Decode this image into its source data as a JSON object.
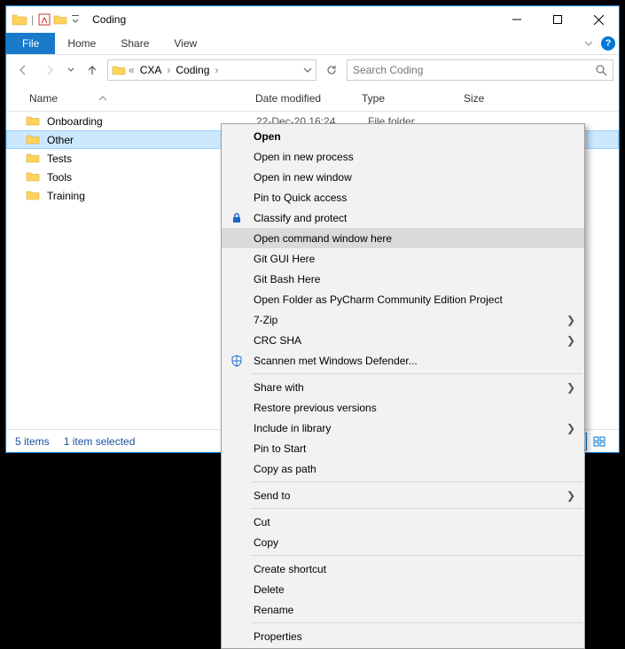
{
  "titlebar": {
    "title": "Coding"
  },
  "ribbon": {
    "file": "File",
    "home": "Home",
    "share": "Share",
    "view": "View"
  },
  "breadcrumb": {
    "prefix": "«",
    "seg1": "CXA",
    "seg2": "Coding"
  },
  "search": {
    "placeholder": "Search Coding"
  },
  "columns": {
    "name": "Name",
    "date": "Date modified",
    "type": "Type",
    "size": "Size"
  },
  "files": [
    {
      "name": "Onboarding",
      "date": "22-Dec-20 16:24",
      "type": "File folder",
      "selected": false
    },
    {
      "name": "Other",
      "date": "",
      "type": "",
      "selected": true
    },
    {
      "name": "Tests",
      "date": "",
      "type": "",
      "selected": false
    },
    {
      "name": "Tools",
      "date": "",
      "type": "",
      "selected": false
    },
    {
      "name": "Training",
      "date": "",
      "type": "",
      "selected": false
    }
  ],
  "status": {
    "items": "5 items",
    "selected": "1 item selected"
  },
  "context": {
    "open": "Open",
    "open_new_process": "Open in new process",
    "open_new_window": "Open in new window",
    "pin_quick": "Pin to Quick access",
    "classify": "Classify and protect",
    "open_cmd": "Open command window here",
    "git_gui": "Git GUI Here",
    "git_bash": "Git Bash Here",
    "pycharm": "Open Folder as PyCharm Community Edition Project",
    "sevenzip": "7-Zip",
    "crc": "CRC SHA",
    "defender": "Scannen met Windows Defender...",
    "share_with": "Share with",
    "restore": "Restore previous versions",
    "include_lib": "Include in library",
    "pin_start": "Pin to Start",
    "copy_path": "Copy as path",
    "send_to": "Send to",
    "cut": "Cut",
    "copy": "Copy",
    "shortcut": "Create shortcut",
    "delete": "Delete",
    "rename": "Rename",
    "properties": "Properties"
  }
}
